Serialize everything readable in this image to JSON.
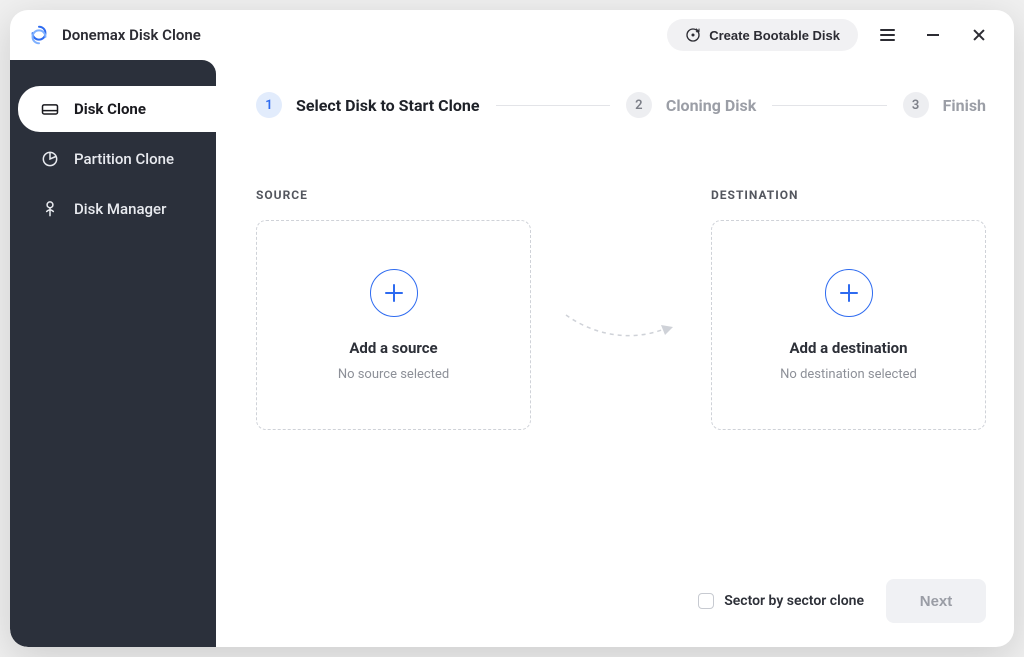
{
  "app": {
    "title": "Donemax Disk Clone"
  },
  "titlebar": {
    "bootable_label": "Create Bootable Disk"
  },
  "sidebar": {
    "items": [
      {
        "label": "Disk Clone",
        "icon": "disk-clone-icon",
        "active": true
      },
      {
        "label": "Partition Clone",
        "icon": "partition-clone-icon",
        "active": false
      },
      {
        "label": "Disk Manager",
        "icon": "disk-manager-icon",
        "active": false
      }
    ]
  },
  "steps": [
    {
      "num": "1",
      "label": "Select Disk to Start Clone",
      "active": true
    },
    {
      "num": "2",
      "label": "Cloning Disk",
      "active": false
    },
    {
      "num": "3",
      "label": "Finish",
      "active": false
    }
  ],
  "zones": {
    "source": {
      "heading": "SOURCE",
      "title": "Add a source",
      "subtitle": "No source selected"
    },
    "destination": {
      "heading": "DESTINATION",
      "title": "Add a destination",
      "subtitle": "No destination selected"
    }
  },
  "footer": {
    "sector_label": "Sector by sector clone",
    "next_label": "Next"
  }
}
